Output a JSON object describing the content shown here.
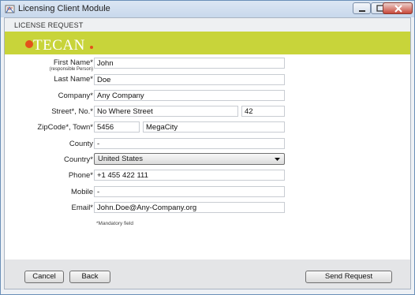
{
  "window": {
    "title": "Licensing Client Module",
    "colors": {
      "accent": "#c8d43a",
      "brand_orange": "#e3521b",
      "titlebar": "#c8d8ec"
    }
  },
  "section": {
    "label": "LICENSE REQUEST"
  },
  "brand": {
    "name": "TECAN"
  },
  "form": {
    "first_name": {
      "label": "First Name*",
      "sublabel": "(responsible Person)",
      "value": "John"
    },
    "last_name": {
      "label": "Last Name*",
      "value": "Doe"
    },
    "company": {
      "label": "Company*",
      "value": "Any Company"
    },
    "street": {
      "label": "Street*, No.*",
      "value": "No Where Street",
      "number": "42"
    },
    "zip_town": {
      "label": "ZipCode*, Town*",
      "zip": "5456",
      "town": "MegaCity"
    },
    "county": {
      "label": "County",
      "value": "-"
    },
    "country": {
      "label": "Country*",
      "value": "United States"
    },
    "phone": {
      "label": "Phone*",
      "value": "+1 455 422 111"
    },
    "mobile": {
      "label": "Mobile",
      "value": "-"
    },
    "email": {
      "label": "Email*",
      "value": "John.Doe@Any-Company.org"
    },
    "mandatory_note": "*Mandatory field"
  },
  "footer": {
    "cancel_label": "Cancel",
    "back_label": "Back",
    "send_label": "Send Request"
  }
}
